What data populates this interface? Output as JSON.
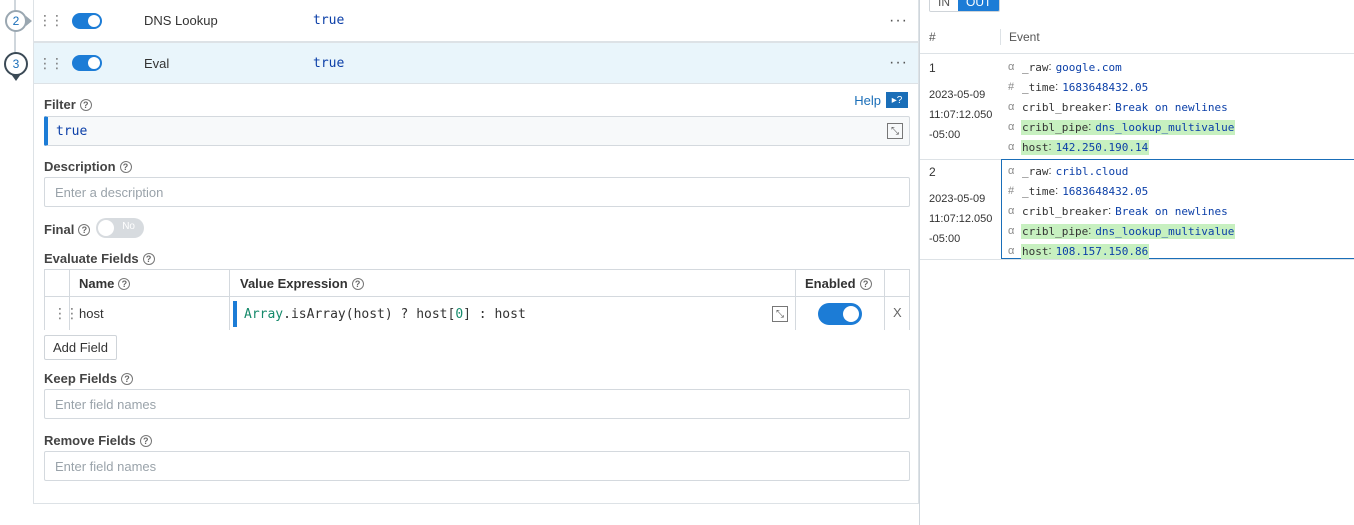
{
  "steps": {
    "step2": "2",
    "step3": "3"
  },
  "functions": [
    {
      "name": "DNS Lookup",
      "value": "true"
    },
    {
      "name": "Eval",
      "value": "true"
    }
  ],
  "eval": {
    "help_label": "Help",
    "filter_label": "Filter",
    "filter_value": "true",
    "description_label": "Description",
    "description_placeholder": "Enter a description",
    "final_label": "Final",
    "final_toggle": "No",
    "evaluate_label": "Evaluate Fields",
    "columns": {
      "name": "Name",
      "value": "Value Expression",
      "enabled": "Enabled"
    },
    "row": {
      "name": "host",
      "expr_kw": "Array",
      "expr_a": ".isArray(host) ? host[",
      "expr_num": "0",
      "expr_b": "] : host",
      "remove": "X"
    },
    "add_field": "Add Field",
    "keep_label": "Keep Fields",
    "keep_placeholder": "Enter field names",
    "remove_label": "Remove Fields",
    "remove_placeholder": "Enter field names"
  },
  "preview": {
    "in_label": "IN",
    "out_label": "OUT",
    "col_index": "#",
    "col_event": "Event",
    "events": [
      {
        "index": "1",
        "date": "2023-05-09",
        "time": "11:07:12.050",
        "tz": "-05:00",
        "fields": [
          {
            "type": "α",
            "name": "_raw",
            "value": "google.com",
            "highlight": false
          },
          {
            "type": "#",
            "name": "_time",
            "value": "1683648432.05",
            "highlight": false
          },
          {
            "type": "α",
            "name": "cribl_breaker",
            "value": "Break on newlines",
            "highlight": false
          },
          {
            "type": "α",
            "name": "cribl_pipe",
            "value": "dns_lookup_multivalue",
            "highlight": true
          },
          {
            "type": "α",
            "name": "host",
            "value": "142.250.190.14",
            "highlight": true
          }
        ]
      },
      {
        "index": "2",
        "date": "2023-05-09",
        "time": "11:07:12.050",
        "tz": "-05:00",
        "fields": [
          {
            "type": "α",
            "name": "_raw",
            "value": "cribl.cloud",
            "highlight": false
          },
          {
            "type": "#",
            "name": "_time",
            "value": "1683648432.05",
            "highlight": false
          },
          {
            "type": "α",
            "name": "cribl_breaker",
            "value": "Break on newlines",
            "highlight": false
          },
          {
            "type": "α",
            "name": "cribl_pipe",
            "value": "dns_lookup_multivalue",
            "highlight": true
          },
          {
            "type": "α",
            "name": "host",
            "value": "108.157.150.86",
            "highlight": true
          }
        ]
      }
    ]
  }
}
